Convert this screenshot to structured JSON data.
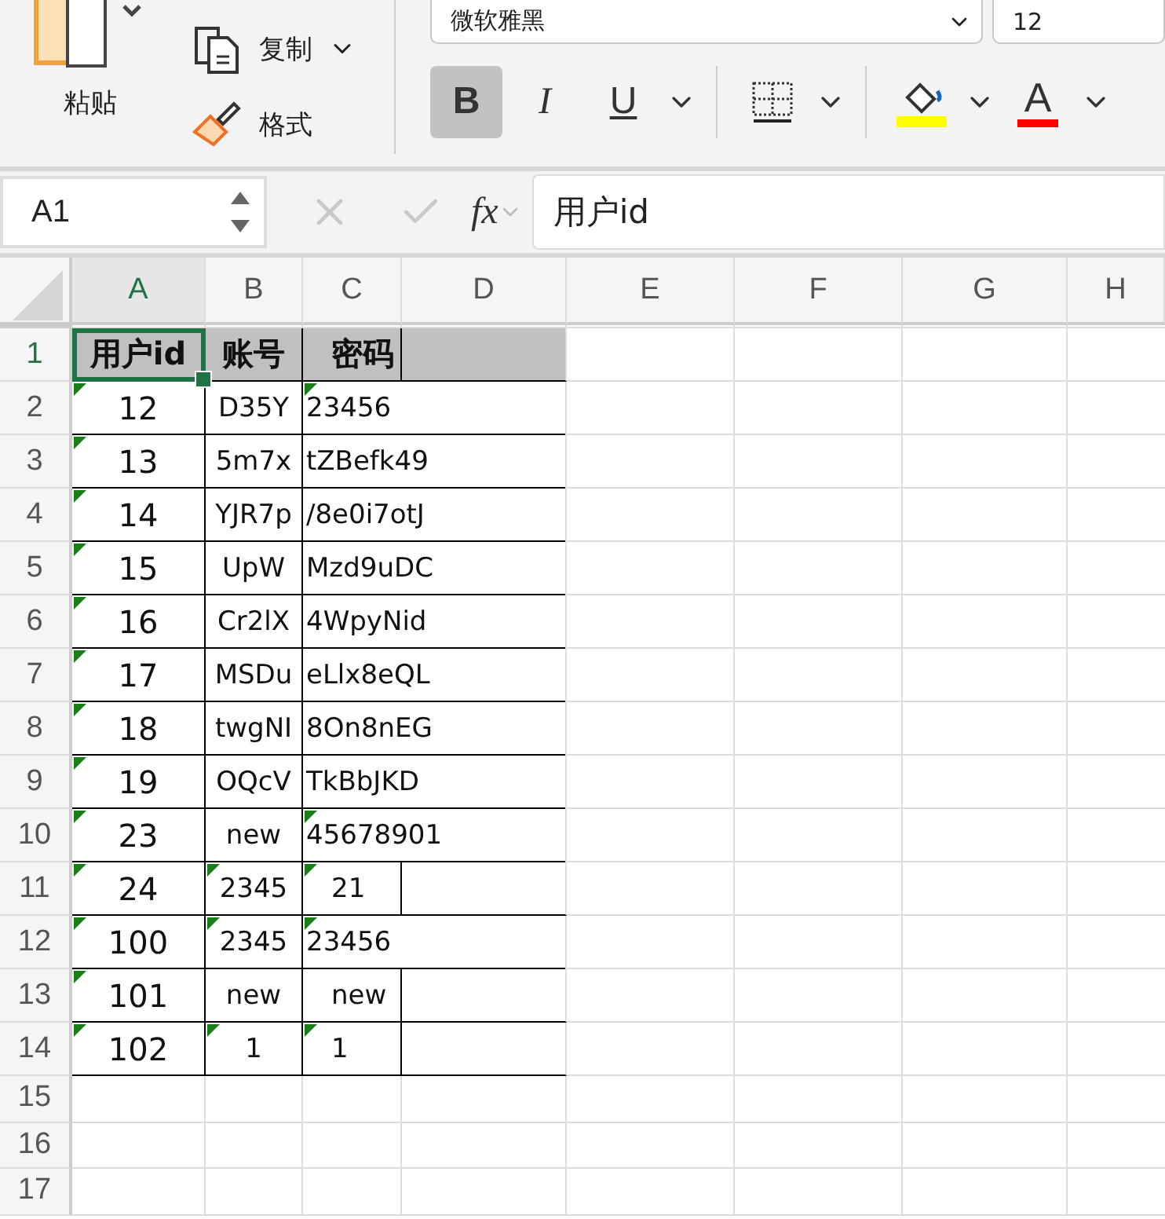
{
  "ribbon": {
    "paste": {
      "label": "粘贴"
    },
    "clipboard": [
      {
        "kind": "copy",
        "label": "复制"
      },
      {
        "kind": "format",
        "label": "格式"
      }
    ],
    "font_name": "微软雅黑",
    "font_size": "12",
    "format_buttons": [
      {
        "kind": "bold",
        "label": "B",
        "pressed": true,
        "dropdown": false
      },
      {
        "kind": "italic",
        "label": "I",
        "pressed": false,
        "dropdown": false
      },
      {
        "kind": "underline",
        "label": "U",
        "pressed": false,
        "dropdown": true
      },
      {
        "kind": "borders",
        "pressed": false,
        "dropdown": true
      },
      {
        "kind": "fill",
        "color": "#ffff00",
        "pressed": false,
        "dropdown": true
      },
      {
        "kind": "fontcolor",
        "label": "A",
        "color": "#ff0000",
        "pressed": false,
        "dropdown": true
      }
    ]
  },
  "formula_bar": {
    "name_box": "A1",
    "fx": "fx",
    "formula": "用户id"
  },
  "columns": [
    {
      "label": "A",
      "selected": true
    },
    {
      "label": "B",
      "selected": false
    },
    {
      "label": "C",
      "selected": false
    },
    {
      "label": "D",
      "selected": false
    },
    {
      "label": "E",
      "selected": false
    },
    {
      "label": "F",
      "selected": false
    },
    {
      "label": "G",
      "selected": false
    },
    {
      "label": "H",
      "selected": false
    }
  ],
  "rows": [
    {
      "number": "1",
      "kind": "header",
      "cells": [
        {
          "text": "用户id",
          "flagged": false,
          "selected": true
        },
        {
          "text": "账号",
          "flagged": false,
          "selected": false
        },
        {
          "text": "密码",
          "flagged": false,
          "selected": false
        }
      ]
    },
    {
      "number": "2",
      "kind": "data",
      "cells": [
        {
          "text": "12",
          "flagged": true,
          "selected": false
        },
        {
          "text": "D35Y",
          "flagged": false,
          "selected": false
        },
        {
          "text": "23456",
          "flagged": true,
          "selected": false
        }
      ]
    },
    {
      "number": "3",
      "kind": "data",
      "cells": [
        {
          "text": "13",
          "flagged": true,
          "selected": false
        },
        {
          "text": "5m7x",
          "flagged": false,
          "selected": false
        },
        {
          "text": "tZBefk49",
          "flagged": false,
          "selected": false
        }
      ]
    },
    {
      "number": "4",
      "kind": "data",
      "cells": [
        {
          "text": "14",
          "flagged": true,
          "selected": false
        },
        {
          "text": "YJR7p",
          "flagged": false,
          "selected": false
        },
        {
          "text": "/8e0i7otJ",
          "flagged": false,
          "selected": false
        }
      ]
    },
    {
      "number": "5",
      "kind": "data",
      "cells": [
        {
          "text": "15",
          "flagged": true,
          "selected": false
        },
        {
          "text": "UpW",
          "flagged": false,
          "selected": false
        },
        {
          "text": "Mzd9uDC",
          "flagged": false,
          "selected": false
        }
      ]
    },
    {
      "number": "6",
      "kind": "data",
      "cells": [
        {
          "text": "16",
          "flagged": true,
          "selected": false
        },
        {
          "text": "Cr2lX",
          "flagged": false,
          "selected": false
        },
        {
          "text": "4WpyNid",
          "flagged": false,
          "selected": false
        }
      ]
    },
    {
      "number": "7",
      "kind": "data",
      "cells": [
        {
          "text": "17",
          "flagged": true,
          "selected": false
        },
        {
          "text": "MSDu",
          "flagged": false,
          "selected": false
        },
        {
          "text": "eLlx8eQL",
          "flagged": false,
          "selected": false
        }
      ]
    },
    {
      "number": "8",
      "kind": "data",
      "cells": [
        {
          "text": "18",
          "flagged": true,
          "selected": false
        },
        {
          "text": "twgNI",
          "flagged": false,
          "selected": false
        },
        {
          "text": "8On8nEG",
          "flagged": false,
          "selected": false
        }
      ]
    },
    {
      "number": "9",
      "kind": "data",
      "cells": [
        {
          "text": "19",
          "flagged": true,
          "selected": false
        },
        {
          "text": "OQcV",
          "flagged": false,
          "selected": false
        },
        {
          "text": "TkBbJKD",
          "flagged": false,
          "selected": false
        }
      ]
    },
    {
      "number": "10",
      "kind": "data",
      "cells": [
        {
          "text": "23",
          "flagged": true,
          "selected": false
        },
        {
          "text": "new",
          "flagged": false,
          "selected": false
        },
        {
          "text": "45678901",
          "flagged": true,
          "selected": false
        }
      ]
    },
    {
      "number": "11",
      "kind": "data",
      "cells": [
        {
          "text": "24",
          "flagged": true,
          "selected": false
        },
        {
          "text": "2345",
          "flagged": true,
          "selected": false
        },
        {
          "text": "21",
          "flagged": true,
          "selected": false
        }
      ]
    },
    {
      "number": "12",
      "kind": "data",
      "cells": [
        {
          "text": "100",
          "flagged": true,
          "selected": false
        },
        {
          "text": "2345",
          "flagged": true,
          "selected": false
        },
        {
          "text": "23456",
          "flagged": true,
          "selected": false
        }
      ]
    },
    {
      "number": "13",
      "kind": "data",
      "cells": [
        {
          "text": "101",
          "flagged": true,
          "selected": false
        },
        {
          "text": "new",
          "flagged": false,
          "selected": false
        },
        {
          "text": "new",
          "flagged": false,
          "selected": false
        }
      ]
    },
    {
      "number": "14",
      "kind": "data",
      "cells": [
        {
          "text": "102",
          "flagged": true,
          "selected": false
        },
        {
          "text": "1",
          "flagged": true,
          "selected": false
        },
        {
          "text": "1",
          "flagged": true,
          "selected": false
        }
      ]
    },
    {
      "number": "15",
      "kind": "data",
      "cells": []
    },
    {
      "number": "16",
      "kind": "data",
      "cells": []
    },
    {
      "number": "17",
      "kind": "data",
      "cells": []
    }
  ]
}
